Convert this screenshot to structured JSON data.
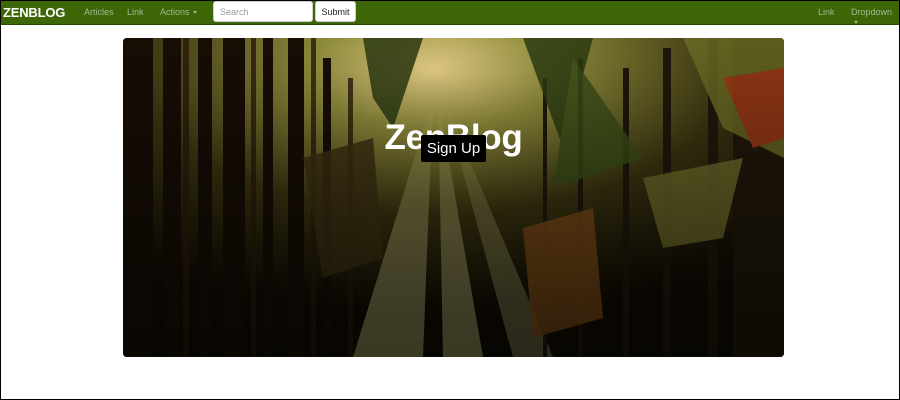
{
  "navbar": {
    "brand": "ZENBLOG",
    "left_links": [
      "Articles",
      "Link"
    ],
    "actions_label": "Actions",
    "search": {
      "placeholder": "Search",
      "value": ""
    },
    "submit_label": "Submit",
    "right_links": [
      "Link"
    ],
    "dropdown_label": "Dropdown"
  },
  "hero": {
    "title": "ZenBlog",
    "signup_label": "Sign Up"
  },
  "colors": {
    "navbar_bg": "#3d6607",
    "nav_link": "#a4b892",
    "button_dark": "#000000"
  },
  "icons": {
    "actions_caret": "caret-down-icon",
    "dropdown_caret": "caret-down-icon"
  }
}
